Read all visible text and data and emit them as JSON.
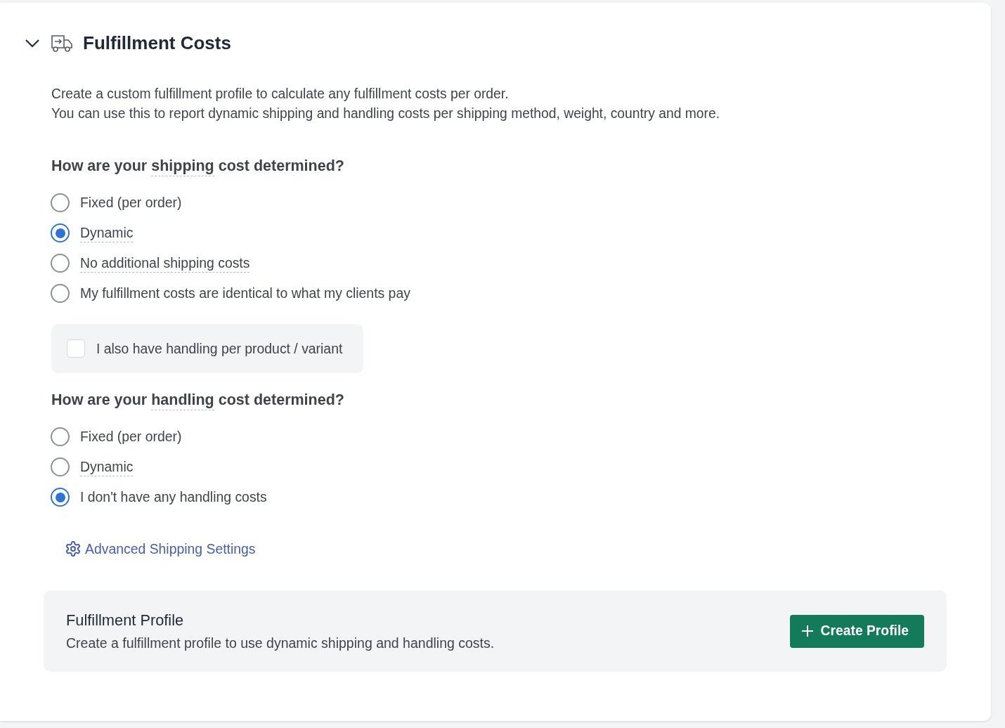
{
  "section": {
    "title": "Fulfillment Costs",
    "expanded": true,
    "description": [
      "Create a custom fulfillment profile to calculate any fulfillment costs per order.",
      "You can use this to report dynamic shipping and handling costs per shipping method, weight, country and more."
    ]
  },
  "shipping": {
    "question": {
      "before": "How are your",
      "term": "shipping",
      "after": "cost determined?"
    },
    "options": [
      {
        "label": "Fixed (per order)",
        "selected": false,
        "dotted": false
      },
      {
        "label": "Dynamic",
        "selected": true,
        "dotted": true
      },
      {
        "label": "No additional shipping costs",
        "selected": false,
        "dotted": true
      },
      {
        "label": "My fulfillment costs are identical to what my clients pay",
        "selected": false,
        "dotted": false
      }
    ]
  },
  "handling_checkbox": {
    "label": "I also have handling per product / variant",
    "checked": false
  },
  "handling": {
    "question": {
      "before": "How are your",
      "term": "handling",
      "after": "cost determined?"
    },
    "options": [
      {
        "label": "Fixed (per order)",
        "selected": false,
        "dotted": false
      },
      {
        "label": "Dynamic",
        "selected": false,
        "dotted": true
      },
      {
        "label": "I don't have any handling costs",
        "selected": true,
        "dotted": false
      }
    ]
  },
  "advanced_link": "Advanced Shipping Settings",
  "profile": {
    "title": "Fulfillment Profile",
    "description": "Create a fulfillment profile to use dynamic shipping and handling costs.",
    "button": "Create Profile"
  }
}
